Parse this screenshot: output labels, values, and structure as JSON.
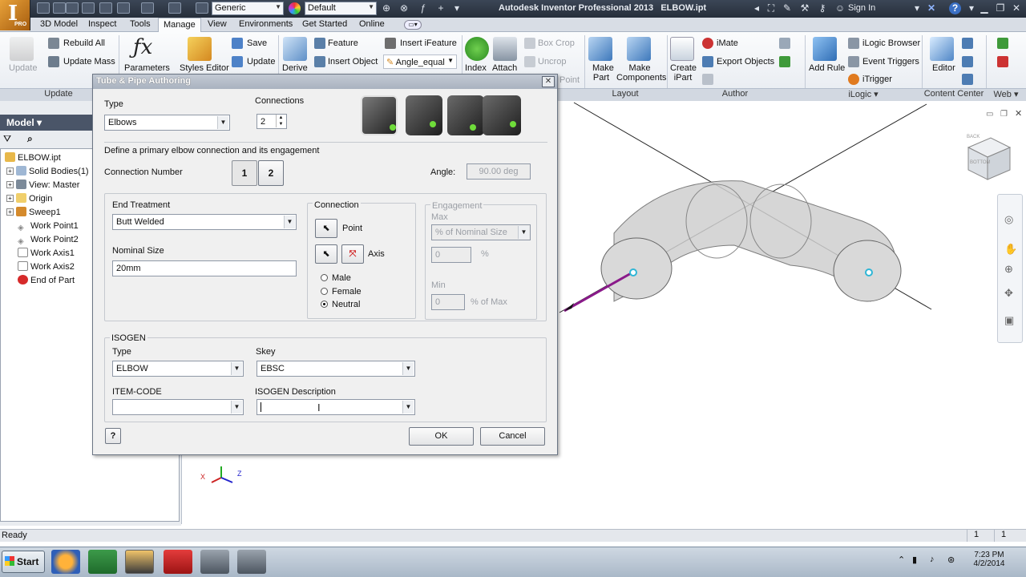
{
  "titlebar": {
    "logo_letter": "I",
    "logo_sub": "PRO",
    "style_combo": "Generic",
    "appearance_combo": "Default",
    "app_title": "Autodesk Inventor Professional 2013",
    "file_title": "ELBOW.ipt",
    "sign_in": "Sign In"
  },
  "tabs": [
    {
      "label": "3D Model"
    },
    {
      "label": "Inspect"
    },
    {
      "label": "Tools"
    },
    {
      "label": "Manage"
    },
    {
      "label": "View"
    },
    {
      "label": "Environments"
    },
    {
      "label": "Get Started"
    },
    {
      "label": "Online"
    }
  ],
  "ribbon": {
    "update": "Update",
    "rebuild_all": "Rebuild All",
    "update_mass": "Update Mass",
    "parameters": "Parameters",
    "styles_editor": "Styles Editor",
    "save": "Save",
    "update_small": "Update",
    "derive": "Derive",
    "feature": "Feature",
    "insert_object": "Insert Object",
    "insert_ifeature": "Insert iFeature",
    "angle_equal": "Angle_equal",
    "index": "Index",
    "attach": "Attach",
    "box_crop": "Box Crop",
    "uncrop": "Uncrop",
    "point": "Point",
    "make_part": "Make Part",
    "make_components": "Make Components",
    "create_ipart": "Create iPart",
    "imate": "iMate",
    "export_objects": "Export Objects",
    "add_rule": "Add Rule",
    "ilogic_browser": "iLogic Browser",
    "event_triggers": "Event Triggers",
    "itrigger": "iTrigger",
    "editor": "Editor",
    "panels": {
      "update": "Update",
      "layout": "Layout",
      "author": "Author",
      "ilogic": "iLogic",
      "content_center": "Content Center",
      "web": "Web"
    }
  },
  "browser": {
    "header": "Model",
    "items": [
      {
        "label": "ELBOW.ipt"
      },
      {
        "label": "Solid Bodies(1)"
      },
      {
        "label": "View: Master"
      },
      {
        "label": "Origin"
      },
      {
        "label": "Sweep1"
      },
      {
        "label": "Work Point1"
      },
      {
        "label": "Work Point2"
      },
      {
        "label": "Work Axis1"
      },
      {
        "label": "Work Axis2"
      },
      {
        "label": "End of Part"
      }
    ]
  },
  "viewcube": {
    "top_label": "BACK",
    "side_label": "BOTTOM"
  },
  "dialog": {
    "title": "Tube & Pipe Authoring",
    "type_label": "Type",
    "type_value": "Elbows",
    "connections_label": "Connections",
    "connections_value": "2",
    "instruction": "Define a primary elbow connection and its engagement",
    "connection_number_label": "Connection Number",
    "conn_1": "1",
    "conn_2": "2",
    "angle_label": "Angle:",
    "angle_value": "90.00 deg",
    "end_treatment_label": "End Treatment",
    "end_treatment_value": "Butt Welded",
    "nominal_size_label": "Nominal Size",
    "nominal_size_value": "20mm",
    "connection_group": "Connection",
    "point_label": "Point",
    "axis_label": "Axis",
    "male": "Male",
    "female": "Female",
    "neutral": "Neutral",
    "engagement_group": "Engagement",
    "max_label": "Max",
    "max_combo": "% of Nominal Size",
    "max_value": "0",
    "percent": "%",
    "min_label": "Min",
    "min_value": "0",
    "pct_of_max": "% of Max",
    "isogen_group": "ISOGEN",
    "iso_type_label": "Type",
    "iso_type_value": "ELBOW",
    "skey_label": "Skey",
    "skey_value": "EBSC",
    "item_code_label": "ITEM-CODE",
    "item_code_value": "",
    "isogen_desc_label": "ISOGEN Description",
    "isogen_desc_value": "",
    "help": "?",
    "ok": "OK",
    "cancel": "Cancel"
  },
  "status": {
    "text": "Ready",
    "field1": "1",
    "field2": "1"
  },
  "taskbar": {
    "start": "Start",
    "time": "7:23 PM",
    "date": "4/2/2014"
  },
  "colors": {
    "titlebar": "#2c3441",
    "accent": "#e8a23a",
    "axis_magenta": "#8a1a8a",
    "point_cyan": "#2fb6d6"
  }
}
